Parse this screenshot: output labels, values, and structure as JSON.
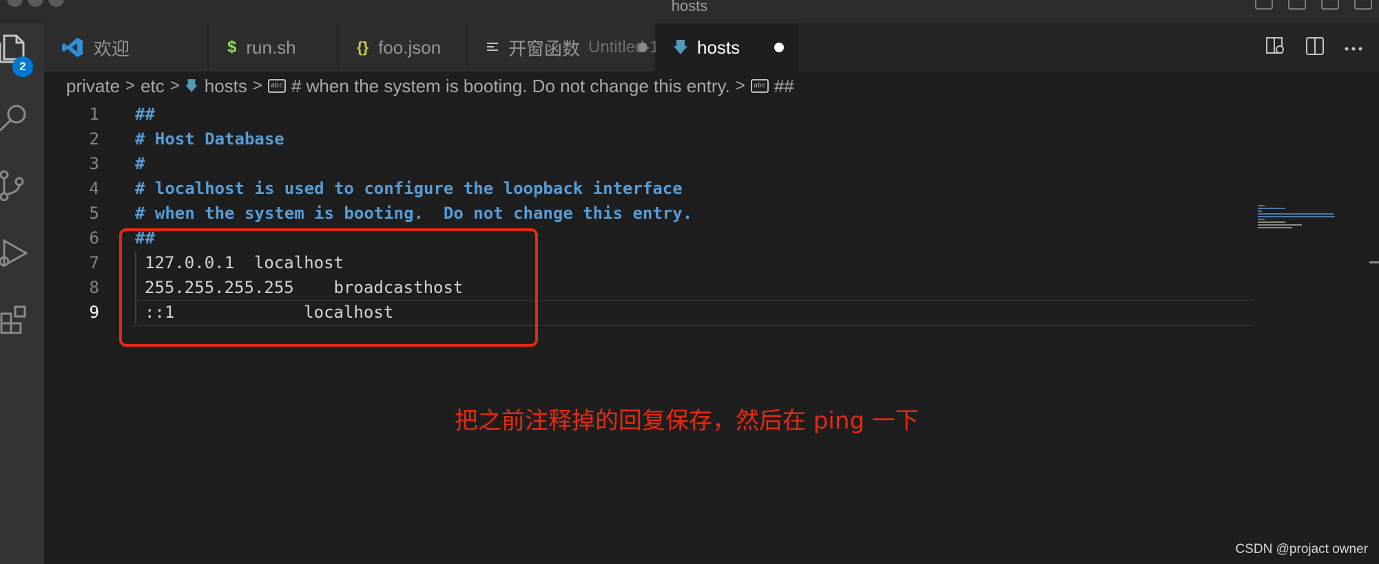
{
  "window": {
    "title": "hosts"
  },
  "activity_bar": {
    "explorer_badge": "2"
  },
  "tabs": [
    {
      "label": "欢迎",
      "icon": "vscode-logo-icon",
      "description": ""
    },
    {
      "label": "run.sh",
      "icon": "dollar-icon",
      "description": ""
    },
    {
      "label": "foo.json",
      "icon": "braces-icon",
      "description": ""
    },
    {
      "label": "开窗函数",
      "icon": "lines-icon",
      "description": "Untitled-1"
    },
    {
      "label": "hosts",
      "icon": "download-arrow-icon",
      "description": ""
    }
  ],
  "breadcrumb": {
    "parts": [
      "private",
      "etc",
      "hosts",
      "# when the system is booting.  Do not change this entry.",
      "##"
    ],
    "separator": ">"
  },
  "editor": {
    "lines": [
      {
        "num": "1",
        "text": "##"
      },
      {
        "num": "2",
        "text": "# Host Database"
      },
      {
        "num": "3",
        "text": "#"
      },
      {
        "num": "4",
        "text": "# localhost is used to configure the loopback interface"
      },
      {
        "num": "5",
        "text": "# when the system is booting.  Do not change this entry."
      },
      {
        "num": "6",
        "text": "##"
      },
      {
        "num": "7",
        "text": "127.0.0.1  localhost"
      },
      {
        "num": "8",
        "text": "255.255.255.255    broadcasthost"
      },
      {
        "num": "9",
        "text": "::1             localhost"
      }
    ]
  },
  "annotation": "把之前注释掉的回复保存，然后在 ping 一下",
  "watermark": "CSDN @projact owner",
  "colors": {
    "background": "#1e1e1e",
    "comment": "#569cd6",
    "annotation_red": "#e8290f",
    "badge_blue": "#0078d4",
    "json_yellow": "#cbcb41",
    "shell_green": "#89e051"
  }
}
